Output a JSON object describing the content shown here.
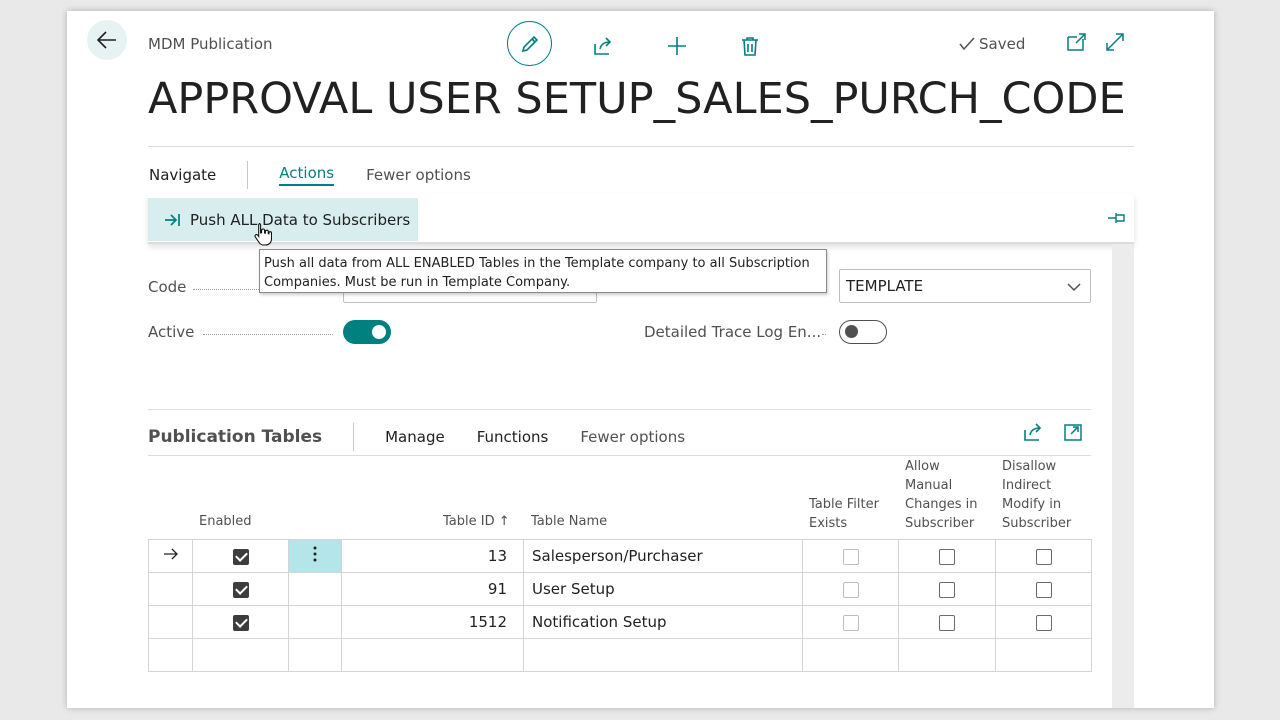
{
  "header": {
    "breadcrumb": "MDM Publication",
    "saved_label": "Saved",
    "title": "APPROVAL USER SETUP_SALES_PURCH_CODE"
  },
  "menu": {
    "navigate": "Navigate",
    "actions": "Actions",
    "fewer": "Fewer options"
  },
  "action_bar": {
    "push_label": "Push ALL Data to Subscribers"
  },
  "tooltip": {
    "line1": "Push all data from ALL ENABLED Tables in the Template company to all Subscription",
    "line2": "Companies.  Must be run in Template Company."
  },
  "general": {
    "code_label": "Code",
    "active_label": "Active",
    "active_on": true,
    "template_value": "TEMPLATE",
    "trace_label": "Detailed Trace Log En...",
    "trace_on": false
  },
  "subpage": {
    "title": "Publication Tables",
    "manage": "Manage",
    "functions": "Functions",
    "fewer": "Fewer options",
    "columns": {
      "enabled": "Enabled",
      "table_id": "Table ID ↑",
      "table_name": "Table Name",
      "filter_exists": [
        "Table Filter",
        "Exists"
      ],
      "allow_manual": [
        "Allow",
        "Manual",
        "Changes in",
        "Subscriber"
      ],
      "disallow": [
        "Disallow",
        "Indirect",
        "Modify in",
        "Subscriber"
      ]
    },
    "rows": [
      {
        "enabled": true,
        "table_id": "13",
        "table_name": "Salesperson/Purchaser",
        "filter_exists": false,
        "allow_manual": false,
        "disallow": false
      },
      {
        "enabled": true,
        "table_id": "91",
        "table_name": "User Setup",
        "filter_exists": false,
        "allow_manual": false,
        "disallow": false
      },
      {
        "enabled": true,
        "table_id": "1512",
        "table_name": "Notification Setup",
        "filter_exists": false,
        "allow_manual": false,
        "disallow": false
      }
    ]
  },
  "colors": {
    "accent": "#00807f",
    "selected_action": "#d8eeee",
    "row_menu": "#b4e5e9"
  },
  "icons": {
    "back": "arrow-left-icon",
    "edit": "pencil-icon",
    "share": "share-icon",
    "new": "plus-icon",
    "delete": "trash-icon",
    "open_new_window": "open-in-new-window-icon",
    "expand": "expand-icon",
    "push": "push-arrow-icon",
    "pin": "pin-icon"
  }
}
